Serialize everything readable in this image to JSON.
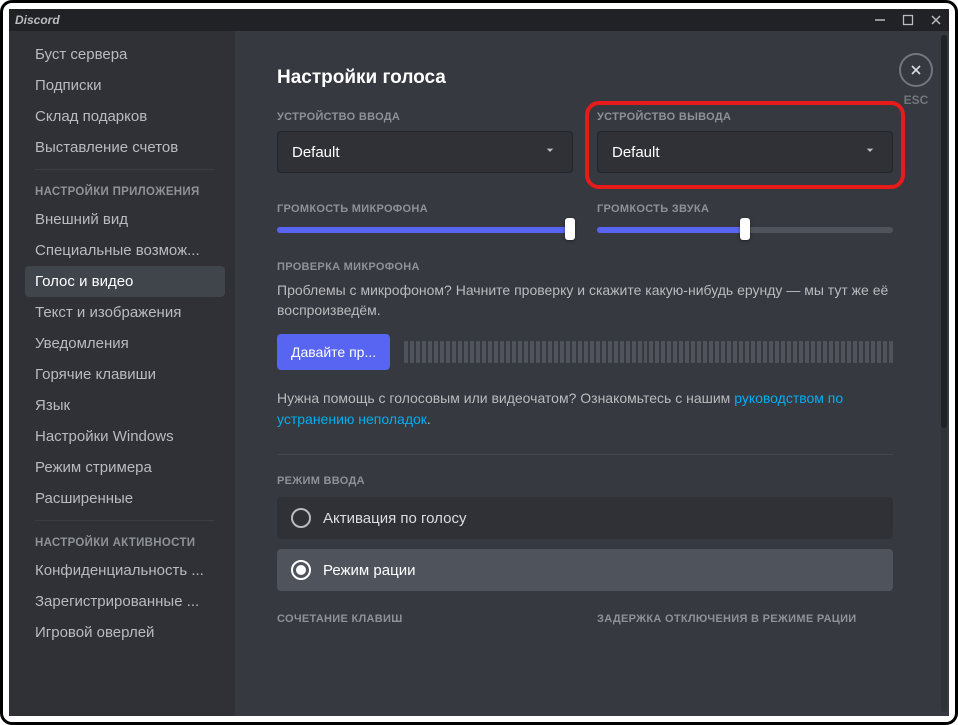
{
  "titlebar": {
    "title": "Discord"
  },
  "sidebar": {
    "items_top": [
      "Буст сервера",
      "Подписки",
      "Склад подарков",
      "Выставление счетов"
    ],
    "header_app": "НАСТРОЙКИ ПРИЛОЖЕНИЯ",
    "items_app": [
      "Внешний вид",
      "Специальные возмож...",
      "Голос и видео",
      "Текст и изображения",
      "Уведомления",
      "Горячие клавиши",
      "Язык",
      "Настройки Windows",
      "Режим стримера",
      "Расширенные"
    ],
    "active_index_app": 2,
    "header_activity": "НАСТРОЙКИ АКТИВНОСТИ",
    "items_activity": [
      "Конфиденциальность ...",
      "Зарегистрированные ...",
      "Игровой оверлей"
    ]
  },
  "content": {
    "title": "Настройки голоса",
    "input_device_label": "УСТРОЙСТВО ВВОДА",
    "input_device_value": "Default",
    "output_device_label": "УСТРОЙСТВО ВЫВОДА",
    "output_device_value": "Default",
    "input_volume_label": "ГРОМКОСТЬ МИКРОФОНА",
    "output_volume_label": "ГРОМКОСТЬ ЗВУКА",
    "input_volume_pct": 99,
    "output_volume_pct": 50,
    "mic_test_label": "ПРОВЕРКА МИКРОФОНА",
    "mic_test_desc": "Проблемы с микрофоном? Начните проверку и скажите какую-нибудь ерунду — мы тут же её воспроизведём.",
    "mic_test_button": "Давайте пр...",
    "help_prefix": "Нужна помощь с голосовым или видеочатом? Ознакомьтесь с нашим ",
    "help_link": "руководством по устранению неполадок",
    "help_period": ".",
    "input_mode_label": "РЕЖИМ ВВОДА",
    "mode_voice": "Активация по голосу",
    "mode_ptt": "Режим рации",
    "selected_mode": 1,
    "shortcut_label": "СОЧЕТАНИЕ КЛАВИШ",
    "ptt_delay_label": "ЗАДЕРЖКА ОТКЛЮЧЕНИЯ В РЕЖИМЕ РАЦИИ"
  },
  "close": {
    "esc": "ESC"
  }
}
